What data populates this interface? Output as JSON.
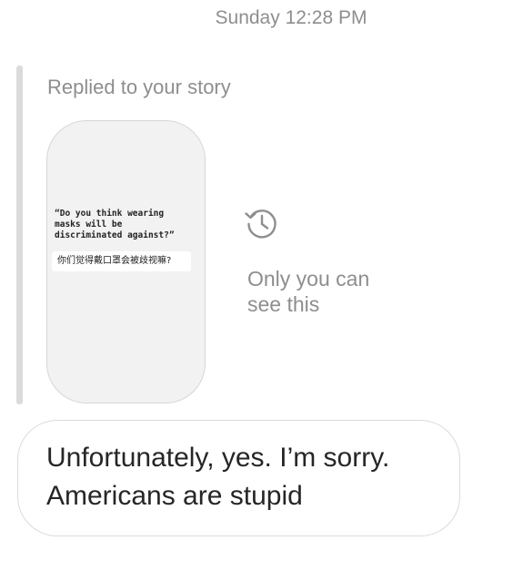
{
  "conversation": {
    "timestamp": "Sunday 12:28 PM"
  },
  "story_reply": {
    "caption": "Replied to your story",
    "story": {
      "quote_lines": [
        "“Do you think wearing",
        "masks will be",
        "discriminated against?”"
      ],
      "sticker_text": "你们觉得戴口罩会被歧视嘛?"
    },
    "private_icon": "history-clock-icon",
    "private_note_lines": [
      "Only you can",
      "see this"
    ]
  },
  "message": {
    "lines": [
      "Unfortunately, yes. I’m sorry.",
      "Americans are stupid"
    ]
  },
  "colors": {
    "muted_text": "#8e8e8e",
    "bubble_border": "#dbdbdb",
    "reply_bar": "#dbdbdb",
    "story_bg": "#f2f2f2"
  }
}
